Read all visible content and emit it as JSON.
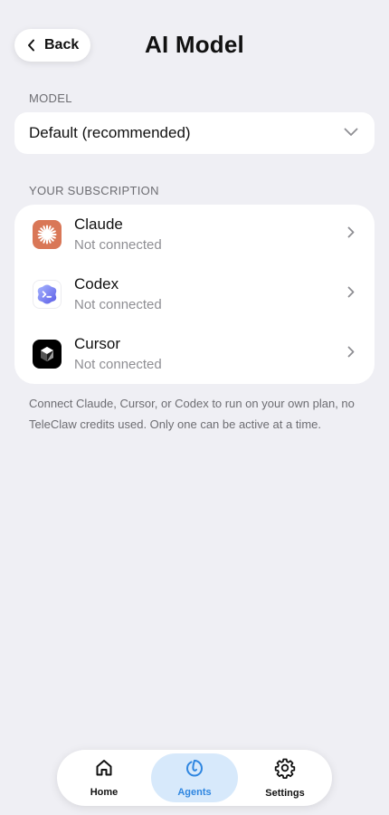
{
  "header": {
    "back_label": "Back",
    "title": "AI Model"
  },
  "model": {
    "section_label": "MODEL",
    "selected": "Default (recommended)"
  },
  "subscription": {
    "section_label": "YOUR SUBSCRIPTION",
    "items": [
      {
        "name": "Claude",
        "status": "Not connected",
        "icon": "claude-logo",
        "color": "#d97757"
      },
      {
        "name": "Codex",
        "status": "Not connected",
        "icon": "codex-logo",
        "color": "#6b7cf0"
      },
      {
        "name": "Cursor",
        "status": "Not connected",
        "icon": "cursor-logo",
        "color": "#000000"
      }
    ],
    "footnote": "Connect Claude, Cursor, or Codex to run on your own plan, no TeleClaw credits used. Only one can be active at a time."
  },
  "tabbar": {
    "tabs": [
      {
        "label": "Home",
        "icon": "home-icon",
        "active": false
      },
      {
        "label": "Agents",
        "icon": "agents-icon",
        "active": true
      },
      {
        "label": "Settings",
        "icon": "gear-icon",
        "active": false
      }
    ],
    "accent": "#2f86e0"
  }
}
